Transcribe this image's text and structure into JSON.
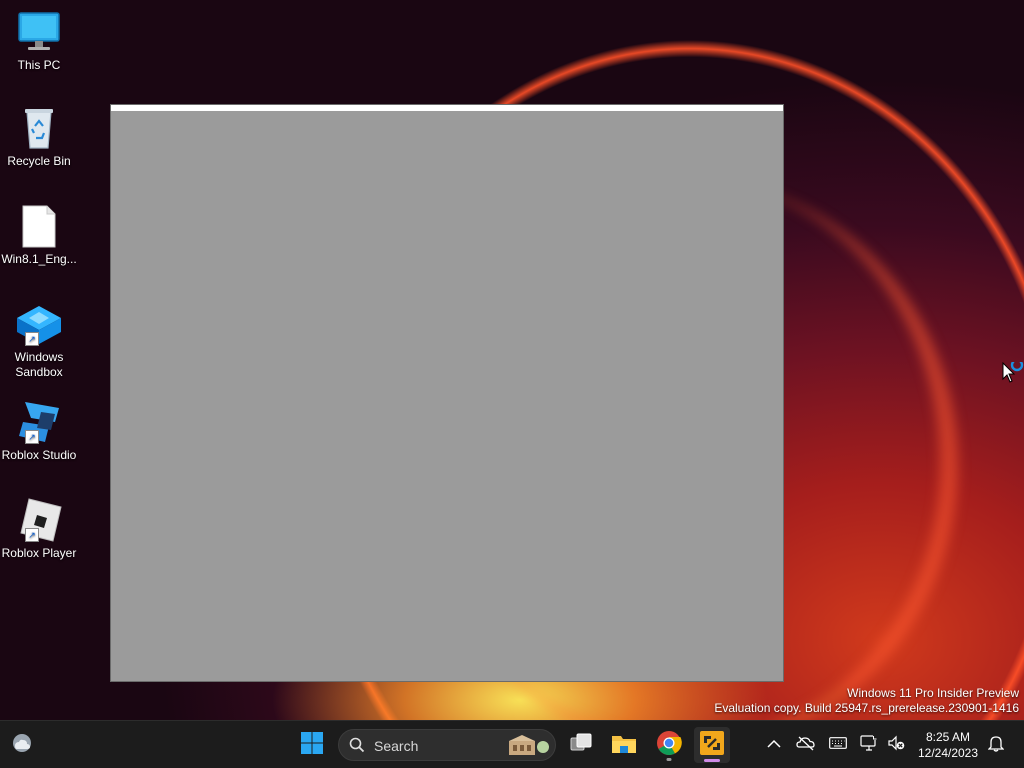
{
  "desktop": {
    "icons": [
      {
        "label": "This PC",
        "icon": "monitor-icon"
      },
      {
        "label": "Recycle Bin",
        "icon": "recycle-bin-icon"
      },
      {
        "label": "Win8.1_Eng...",
        "icon": "file-icon"
      },
      {
        "label": "Windows Sandbox",
        "icon": "sandbox-icon"
      },
      {
        "label": "Roblox Studio",
        "icon": "roblox-studio-icon"
      },
      {
        "label": "Roblox Player",
        "icon": "roblox-player-icon"
      }
    ]
  },
  "window": {
    "content_color": "#9b9b9b"
  },
  "watermark": {
    "line1": "Windows 11 Pro Insider Preview",
    "line2": "Evaluation copy. Build 25947.rs_prerelease.230901-1416"
  },
  "taskbar": {
    "search_placeholder": "Search",
    "pinned": [
      "weather-icon",
      "start-icon",
      "task-view-icon",
      "file-explorer-icon",
      "chrome-icon",
      "active-app-icon"
    ],
    "tray_icons": [
      "chevron-up-icon",
      "onedrive-offline-icon",
      "keyboard-icon",
      "network-icon",
      "volume-muted-icon",
      "notification-bell-icon"
    ],
    "clock": {
      "time": "8:25 AM",
      "date": "12/24/2023"
    }
  },
  "colors": {
    "taskbar_bg": "#1c1c1c",
    "accent": "#0078d4",
    "active_indicator": "#d08be8"
  }
}
